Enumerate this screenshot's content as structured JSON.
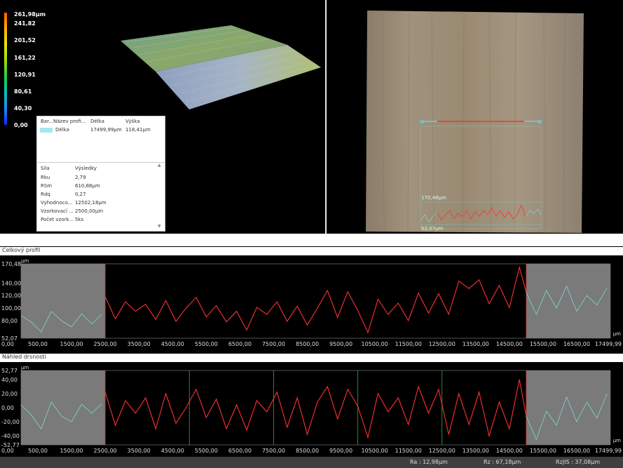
{
  "legend": {
    "values": [
      "261,98µm",
      "241,82",
      "201,52",
      "161,22",
      "120,91",
      "80,61",
      "40,30",
      "0,00"
    ]
  },
  "popup": {
    "header": {
      "col1": "Bar...",
      "col2": "Název profi...",
      "col3": "Délka",
      "col4": "Výška"
    },
    "profile": {
      "name": "Délka",
      "length": "17499,99µm",
      "height": "118,41µm"
    },
    "results_header": {
      "col1": "Síla",
      "col2": "Výsledky"
    },
    "rows": [
      {
        "label": "Rku",
        "value": "2,79"
      },
      {
        "label": "RSm",
        "value": "610,88µm"
      },
      {
        "label": "Rdq",
        "value": "0,27"
      },
      {
        "label": "Vyhodnoco...",
        "value": "12502,18µm"
      },
      {
        "label": "Vzorkovací ...",
        "value": "2500,00µm"
      },
      {
        "label": "Počet vzork...",
        "value": "5ks"
      }
    ]
  },
  "image_view": {
    "inset_top": "170,48µm",
    "inset_bottom": "52,07µm"
  },
  "sections": {
    "total_profile": "Celkový profil",
    "roughness_preview": "Náhled drsnosti"
  },
  "units": {
    "um": "µm"
  },
  "chart_data": [
    {
      "type": "line",
      "title": "Celkový profil",
      "ylabel": "µm",
      "xlabel": "µm",
      "ylim": [
        52.07,
        170.48
      ],
      "xlim": [
        0,
        17499.99
      ],
      "y_ticks": [
        "170,48",
        "140,00",
        "120,00",
        "100,00",
        "80,00",
        "52,07"
      ],
      "x_ticks": [
        "0,00",
        "500,00",
        "1500,00",
        "2500,00",
        "3500,00",
        "4500,00",
        "5500,00",
        "6500,00",
        "7500,00",
        "8500,00",
        "9500,00",
        "10500,00",
        "11500,00",
        "12500,00",
        "13500,00",
        "14500,00",
        "15500,00",
        "16500,00",
        "17499,99"
      ],
      "excluded_ranges": [
        [
          0,
          2500
        ],
        [
          15000,
          17499.99
        ]
      ],
      "series": [
        {
          "x": [
            0,
            300,
            600,
            900,
            1200,
            1500,
            1800,
            2100,
            2400
          ],
          "values": [
            88,
            78,
            62,
            95,
            80,
            70,
            91,
            75,
            90
          ]
        },
        {
          "x": [
            2500,
            2800,
            3100,
            3400,
            3700,
            4000,
            4300,
            4600,
            4900,
            5200,
            5500,
            5800,
            6100,
            6400,
            6700,
            7000,
            7300,
            7600,
            7900,
            8200,
            8500,
            8800,
            9100,
            9400,
            9700,
            10000,
            10300,
            10600,
            10900,
            11200,
            11500,
            11800,
            12100,
            12400,
            12700,
            13000,
            13300,
            13600,
            13900,
            14200,
            14500,
            14800,
            15000
          ],
          "values": [
            118,
            83,
            110,
            95,
            106,
            82,
            112,
            79,
            100,
            117,
            86,
            104,
            78,
            95,
            65,
            101,
            90,
            110,
            79,
            103,
            73,
            100,
            128,
            85,
            126,
            96,
            61,
            114,
            90,
            108,
            80,
            124,
            92,
            123,
            90,
            143,
            131,
            145,
            107,
            136,
            101,
            165,
            125
          ]
        },
        {
          "x": [
            15000,
            15300,
            15600,
            15900,
            16200,
            16500,
            16800,
            17100,
            17400
          ],
          "values": [
            125,
            90,
            128,
            100,
            135,
            95,
            120,
            105,
            132
          ]
        }
      ]
    },
    {
      "type": "line",
      "title": "Náhled drsnosti",
      "ylabel": "µm",
      "xlabel": "µm",
      "ylim": [
        -52.77,
        52.77
      ],
      "xlim": [
        0,
        17499.99
      ],
      "y_ticks": [
        "52,77",
        "40,00",
        "20,00",
        "0,00",
        "-20,00",
        "-40,00",
        "-52,77"
      ],
      "x_ticks": [
        "0,00",
        "500,00",
        "1500,00",
        "2500,00",
        "3500,00",
        "4500,00",
        "5500,00",
        "6500,00",
        "7500,00",
        "8500,00",
        "9500,00",
        "10500,00",
        "11500,00",
        "12500,00",
        "13500,00",
        "14500,00",
        "15500,00",
        "16500,00",
        "17499,99"
      ],
      "excluded_ranges": [
        [
          0,
          2500
        ],
        [
          15000,
          17499.99
        ]
      ],
      "cutoffs": [
        5000,
        7500,
        10000,
        12500
      ],
      "series": [
        {
          "x": [
            0,
            300,
            600,
            900,
            1200,
            1500,
            1800,
            2100,
            2400
          ],
          "values": [
            4,
            -10,
            -30,
            8,
            -12,
            -20,
            5,
            -8,
            6
          ]
        },
        {
          "x": [
            2500,
            2800,
            3100,
            3400,
            3700,
            4000,
            4300,
            4600,
            4900,
            5200,
            5500,
            5800,
            6100,
            6400,
            6700,
            7000,
            7300,
            7600,
            7900,
            8200,
            8500,
            8800,
            9100,
            9400,
            9700,
            10000,
            10300,
            10600,
            10900,
            11200,
            11500,
            11800,
            12100,
            12400,
            12700,
            13000,
            13300,
            13600,
            13900,
            14200,
            14500,
            14800,
            15000
          ],
          "values": [
            22,
            -25,
            10,
            -8,
            14,
            -30,
            20,
            -22,
            0,
            26,
            -14,
            12,
            -30,
            4,
            -32,
            10,
            -6,
            22,
            -28,
            14,
            -38,
            8,
            30,
            -16,
            26,
            2,
            -42,
            20,
            -6,
            14,
            -24,
            30,
            -8,
            26,
            -38,
            20,
            -24,
            22,
            -40,
            8,
            -30,
            40,
            -12
          ]
        },
        {
          "x": [
            15000,
            15300,
            15600,
            15900,
            16200,
            16500,
            16800,
            17100,
            17400
          ],
          "values": [
            -12,
            -45,
            -5,
            -25,
            15,
            -20,
            8,
            -15,
            20
          ]
        }
      ]
    }
  ],
  "status": {
    "ra": "Ra : 12,98µm",
    "rz": "Rz : 67,18µm",
    "rzjis": "RzJIS : 37,08µm"
  }
}
